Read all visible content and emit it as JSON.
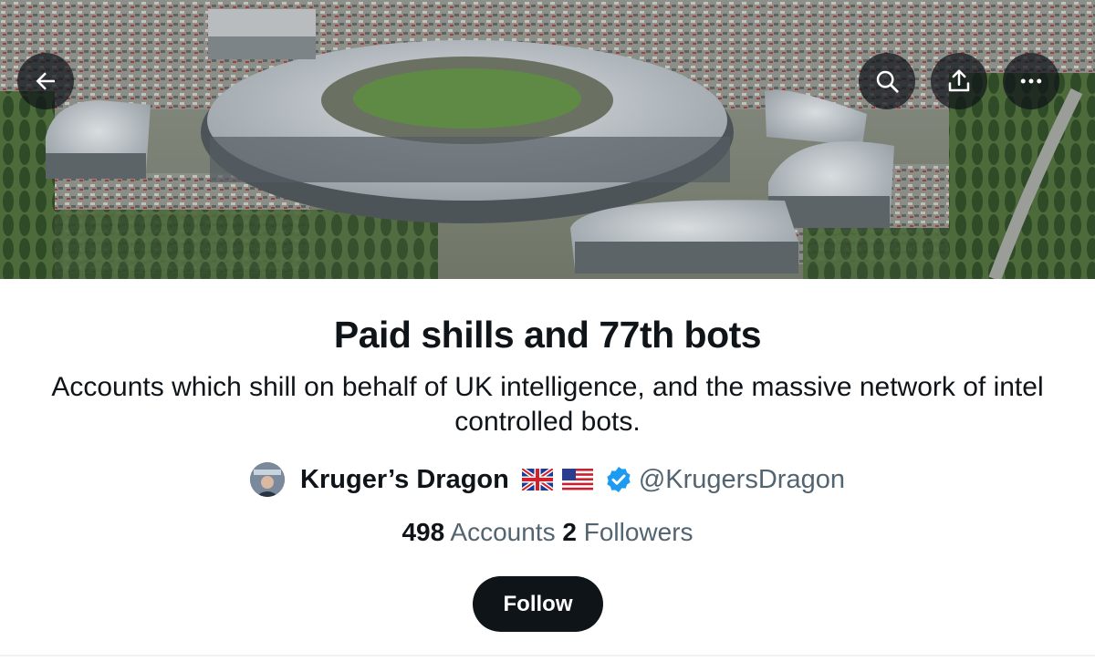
{
  "banner": {
    "image_description_icon": "gchq-building-aerial-photo",
    "buttons": {
      "back": "back-arrow-icon",
      "search": "search-icon",
      "share": "share-icon",
      "more": "more-icon"
    }
  },
  "list": {
    "title": "Paid shills and 77th bots",
    "description": "Accounts which shill on behalf of UK intelligence, and the massive network of intel controlled bots.",
    "owner": {
      "name": "Kruger’s Dragon",
      "handle": "@KrugersDragon",
      "flags": [
        "uk-flag-icon",
        "us-flag-icon"
      ],
      "verified": true
    },
    "stats": {
      "accounts_count": "498",
      "accounts_label": "Accounts",
      "followers_count": "2",
      "followers_label": "Followers"
    },
    "follow_label": "Follow"
  },
  "colors": {
    "text_primary": "#0f1419",
    "text_secondary": "#536471",
    "verified_blue": "#1d9bf0",
    "button_bg": "#0f1419"
  }
}
